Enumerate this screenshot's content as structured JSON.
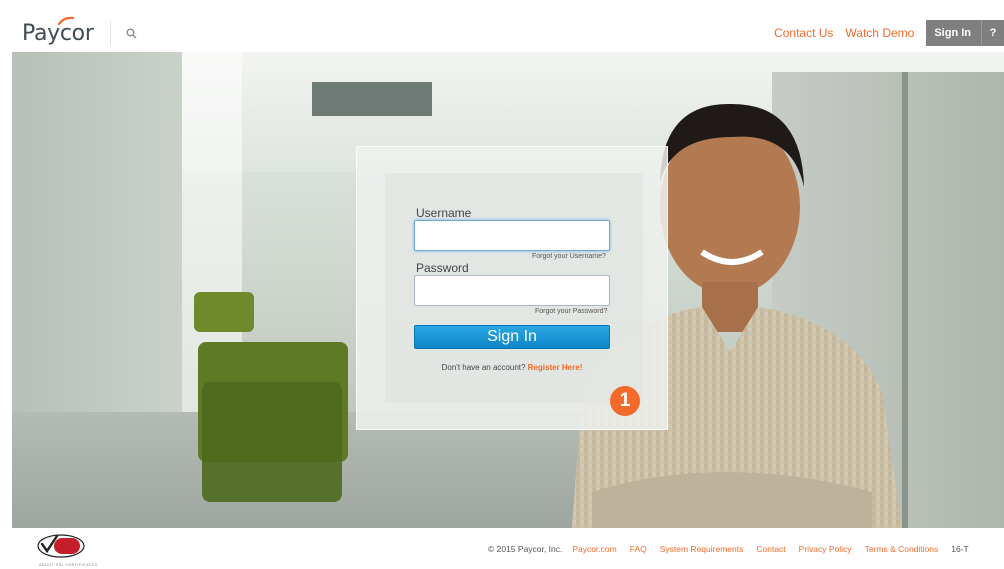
{
  "header": {
    "logo_text": "Paycor",
    "links": [
      "Contact Us",
      "Watch Demo"
    ],
    "signin_label": "Sign In",
    "help_label": "?"
  },
  "login": {
    "username_label": "Username",
    "username_value": "",
    "forgot_username": "Forgot your Username?",
    "password_label": "Password",
    "password_value": "",
    "forgot_password": "Forgot your Password?",
    "signin_button": "Sign In",
    "register_prompt": "Don't have an account?",
    "register_link": "Register Here!"
  },
  "badge": "1",
  "footer": {
    "ssl_caption": "ABOUT SSL CERTIFICATES",
    "copyright": "© 2015 Paycor, Inc.",
    "links": [
      "Paycor.com",
      "FAQ",
      "System Requirements",
      "Contact",
      "Privacy Policy",
      "Terms & Conditions"
    ],
    "version": "16-T"
  },
  "colors": {
    "accent": "#f26b2a",
    "button_blue": "#1796d6",
    "logo": "#3f4b5a"
  },
  "icons": {
    "search": "search-icon",
    "verisign": "verisign-seal-icon"
  }
}
